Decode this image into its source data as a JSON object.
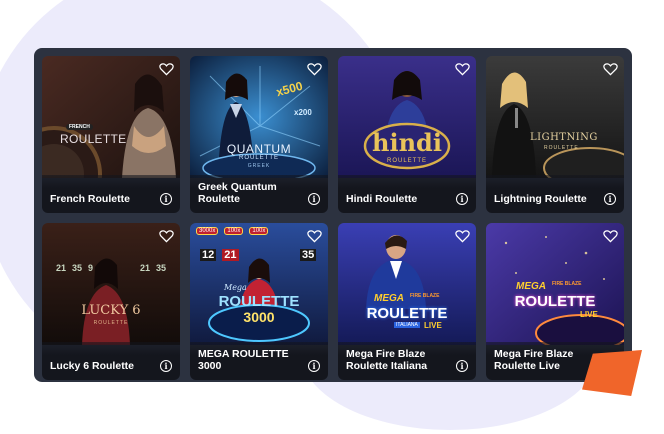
{
  "games": [
    {
      "name": "French Roulette",
      "logo_small": "FRENCH",
      "logo": "ROULETTE",
      "colors": [
        "#4a2a22",
        "#1d120f"
      ],
      "logo_color": "#e9dfe2"
    },
    {
      "name": "Greek Quantum Roulette",
      "logo": "QUANTUM",
      "logo_sub": "ROULETTE",
      "logo_sub2": "GREEK",
      "badge1": "x500",
      "badge2": "x200",
      "colors": [
        "#1d5b8e",
        "#0c1f3d"
      ],
      "logo_color": "#e8f2ff"
    },
    {
      "name": "Hindi Roulette",
      "logo": "hindi",
      "logo_sub": "ROULETTE",
      "colors": [
        "#3a2f8a",
        "#1b1656"
      ],
      "logo_color": "#e9c35a"
    },
    {
      "name": "Lightning Roulette",
      "logo": "LIGHTNING",
      "logo_sub": "ROULETTE",
      "colors": [
        "#3b3b3b",
        "#141414"
      ],
      "logo_color": "#e5d1a0"
    },
    {
      "name": "Lucky 6 Roulette",
      "logo": "LUCKY 6",
      "logo_sub": "ROULETTE",
      "numbers": [
        "21",
        "35",
        "9",
        "21",
        "35"
      ],
      "colors": [
        "#3a2018",
        "#120c0a"
      ],
      "logo_color": "#f0c9a0"
    },
    {
      "name": "MEGA ROULETTE 3000",
      "logo_small": "Mega",
      "logo": "ROULETTE",
      "logo_sub": "3000",
      "chips": [
        "3000x",
        "100x",
        "100x"
      ],
      "numbers": [
        "12",
        "21",
        "35"
      ],
      "colors": [
        "#2a4d9c",
        "#101a3e"
      ],
      "logo_color": "#9fe2ff"
    },
    {
      "name": "Mega Fire Blaze Roulette Italiana",
      "logo_small": "MEGA",
      "logo_small2": "FIRE BLAZE",
      "logo": "ROULETTE",
      "logo_sub": "ITALIANA",
      "logo_sub2": "LIVE",
      "colors": [
        "#3a3fb4",
        "#141a57"
      ],
      "logo_color": "#ffffff"
    },
    {
      "name": "Mega Fire Blaze Roulette Live",
      "logo_small": "MEGA",
      "logo_small2": "FIRE BLAZE",
      "logo": "ROULETTE",
      "logo_sub": "LIVE",
      "colors": [
        "#4b3aa8",
        "#1c1352"
      ],
      "logo_color": "#ffffff"
    }
  ]
}
